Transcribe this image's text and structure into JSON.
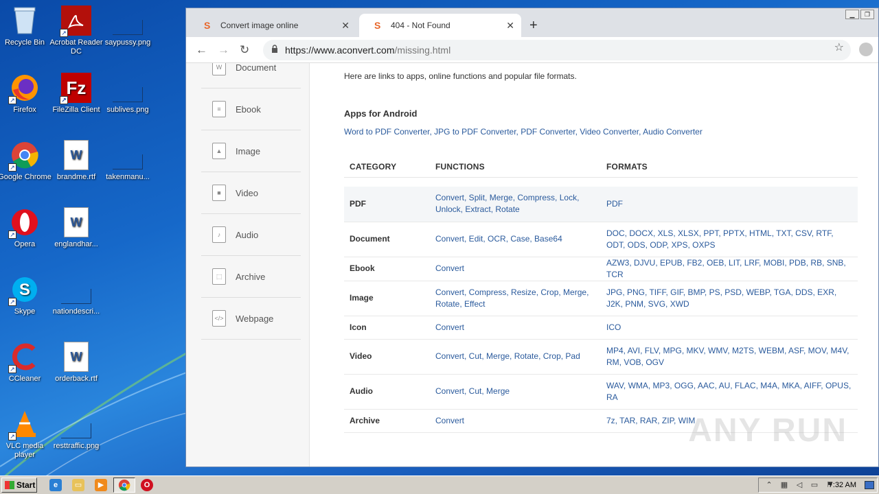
{
  "desktop": {
    "icons": [
      {
        "label": "Recycle Bin",
        "icon": "recycle-bin-icon"
      },
      {
        "label": "Acrobat Reader DC",
        "icon": "acrobat-icon"
      },
      {
        "label": "saypussy.png",
        "icon": "image-file-icon"
      },
      {
        "label": "Firefox",
        "icon": "firefox-icon"
      },
      {
        "label": "FileZilla Client",
        "icon": "filezilla-icon"
      },
      {
        "label": "sublives.png",
        "icon": "image-file-icon"
      },
      {
        "label": "Google Chrome",
        "icon": "chrome-icon"
      },
      {
        "label": "brandme.rtf",
        "icon": "word-doc-icon"
      },
      {
        "label": "takenmanu...",
        "icon": "image-file-icon"
      },
      {
        "label": "Opera",
        "icon": "opera-icon"
      },
      {
        "label": "englandhar...",
        "icon": "word-doc-icon"
      },
      {
        "label": "Skype",
        "icon": "skype-icon"
      },
      {
        "label": "nationdescri...",
        "icon": "image-file-icon"
      },
      {
        "label": "CCleaner",
        "icon": "ccleaner-icon"
      },
      {
        "label": "orderback.rtf",
        "icon": "word-doc-icon"
      },
      {
        "label": "VLC media player",
        "icon": "vlc-icon"
      },
      {
        "label": "resttraffic.png",
        "icon": "image-file-icon"
      }
    ]
  },
  "browser": {
    "tabs": [
      {
        "label": "Convert image online",
        "state": "inactive"
      },
      {
        "label": "404 - Not Found",
        "state": "active"
      }
    ],
    "url_host": "https://www.aconvert.com",
    "url_path": "/missing.html"
  },
  "sidebar": {
    "items": [
      {
        "label": "Document",
        "icon": "document-icon",
        "glyph": "W"
      },
      {
        "label": "Ebook",
        "icon": "ebook-icon",
        "glyph": "≡"
      },
      {
        "label": "Image",
        "icon": "image-icon",
        "glyph": "▲"
      },
      {
        "label": "Video",
        "icon": "video-icon",
        "glyph": "■"
      },
      {
        "label": "Audio",
        "icon": "audio-icon",
        "glyph": "♪"
      },
      {
        "label": "Archive",
        "icon": "archive-icon",
        "glyph": "⬚"
      },
      {
        "label": "Webpage",
        "icon": "webpage-icon",
        "glyph": "</>"
      }
    ]
  },
  "content": {
    "intro": "Here are links to apps, online functions and popular file formats.",
    "apps_heading": "Apps for Android",
    "apps_links": [
      "Word to PDF Converter",
      "JPG to PDF Converter",
      "PDF Converter",
      "Video Converter",
      "Audio Converter"
    ],
    "table": {
      "headers": [
        "CATEGORY",
        "FUNCTIONS",
        "FORMATS"
      ],
      "rows": [
        {
          "category": "PDF",
          "functions": "Convert, Split, Merge, Compress, Lock, Unlock, Extract, Rotate",
          "formats": "PDF"
        },
        {
          "category": "Document",
          "functions": "Convert, Edit, OCR, Case, Base64",
          "formats": "DOC, DOCX, XLS, XLSX, PPT, PPTX, HTML, TXT, CSV, RTF, ODT, ODS, ODP, XPS, OXPS"
        },
        {
          "category": "Ebook",
          "functions": "Convert",
          "formats": "AZW3, DJVU, EPUB, FB2, OEB, LIT, LRF, MOBI, PDB, RB, SNB, TCR"
        },
        {
          "category": "Image",
          "functions": "Convert, Compress, Resize, Crop, Merge, Rotate, Effect",
          "formats": "JPG, PNG, TIFF, GIF, BMP, PS, PSD, WEBP, TGA, DDS, EXR, J2K, PNM, SVG, XWD"
        },
        {
          "category": "Icon",
          "functions": "Convert",
          "formats": "ICO"
        },
        {
          "category": "Video",
          "functions": "Convert, Cut, Merge, Rotate, Crop, Pad",
          "formats": "MP4, AVI, FLV, MPG, MKV, WMV, M2TS, WEBM, ASF, MOV, M4V, RM, VOB, OGV"
        },
        {
          "category": "Audio",
          "functions": "Convert, Cut, Merge",
          "formats": "WAV, WMA, MP3, OGG, AAC, AU, FLAC, M4A, MKA, AIFF, OPUS, RA"
        },
        {
          "category": "Archive",
          "functions": "Convert",
          "formats": "7z, TAR, RAR, ZIP, WIM"
        }
      ]
    }
  },
  "watermark": "ANY RUN",
  "taskbar": {
    "start_label": "Start",
    "clock": "7:32 AM"
  },
  "colors": {
    "link": "#2a5a9c",
    "desktop_bg": "#1668c9",
    "accent_tab_icon": "#e8662a"
  }
}
